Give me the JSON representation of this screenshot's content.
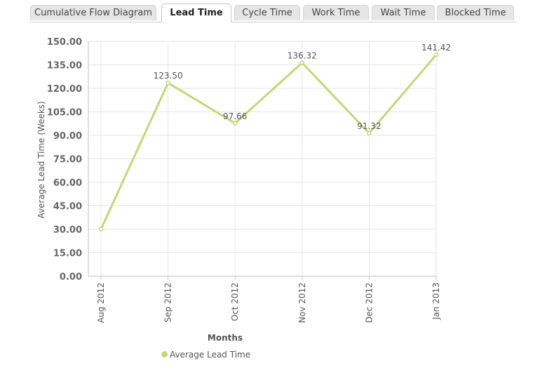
{
  "tabs": [
    {
      "label": "Cumulative Flow Diagram",
      "active": false
    },
    {
      "label": "Lead Time",
      "active": true
    },
    {
      "label": "Cycle Time",
      "active": false
    },
    {
      "label": "Work Time",
      "active": false
    },
    {
      "label": "Wait Time",
      "active": false
    },
    {
      "label": "Blocked Time",
      "active": false
    }
  ],
  "colors": {
    "series": "#c3d877",
    "grid": "#e6e6e6",
    "axis": "#c0c0c0"
  },
  "legend": {
    "label": "Average Lead Time"
  },
  "chart_data": {
    "type": "line",
    "title": "",
    "xlabel": "Months",
    "ylabel": "Average Lead Time (Weeks)",
    "categories": [
      "Aug 2012",
      "Sep 2012",
      "Oct 2012",
      "Nov 2012",
      "Dec 2012",
      "Jan 2013"
    ],
    "series": [
      {
        "name": "Average Lead Time",
        "values": [
          30,
          123.5,
          97.66,
          136.32,
          91.32,
          141.42
        ]
      }
    ],
    "data_labels": [
      "",
      "123.50",
      "97.66",
      "136.32",
      "91.32",
      "141.42"
    ],
    "yticks": [
      "0.00",
      "15.00",
      "30.00",
      "45.00",
      "60.00",
      "75.00",
      "90.00",
      "105.00",
      "120.00",
      "135.00",
      "150.00"
    ],
    "ylim": [
      0,
      150
    ],
    "grid": true,
    "legend_position": "bottom-left"
  }
}
